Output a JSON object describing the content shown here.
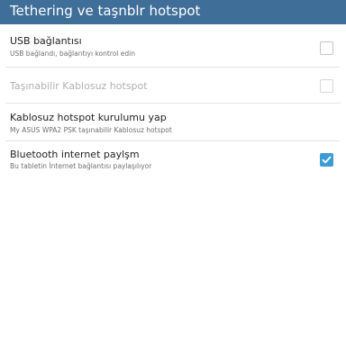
{
  "header": {
    "title": "Tethering ve taşnblr hotspot"
  },
  "settings": [
    {
      "title": "USB bağlantısı",
      "subtitle": "USB bağlandı, bağlantıyı kontrol edin",
      "checked": false,
      "enabled": true
    },
    {
      "title": "Taşınabilir Kablosuz hotspot",
      "subtitle": "",
      "checked": false,
      "enabled": false
    },
    {
      "title": "Kablosuz hotspot kurulumu yap",
      "subtitle": "My ASUS WPA2 PSK taşınabilir Kablosuz hotspot",
      "checked": null,
      "enabled": true
    },
    {
      "title": "Bluetooth internet paylşm",
      "subtitle": "Bu tabletin İnternet bağlantısı paylaşılıyor",
      "checked": true,
      "enabled": true
    }
  ],
  "colors": {
    "header_bg": "#3f6e99",
    "accent": "#3d9bd6"
  },
  "icons": {
    "checked": "checkmark-icon"
  }
}
